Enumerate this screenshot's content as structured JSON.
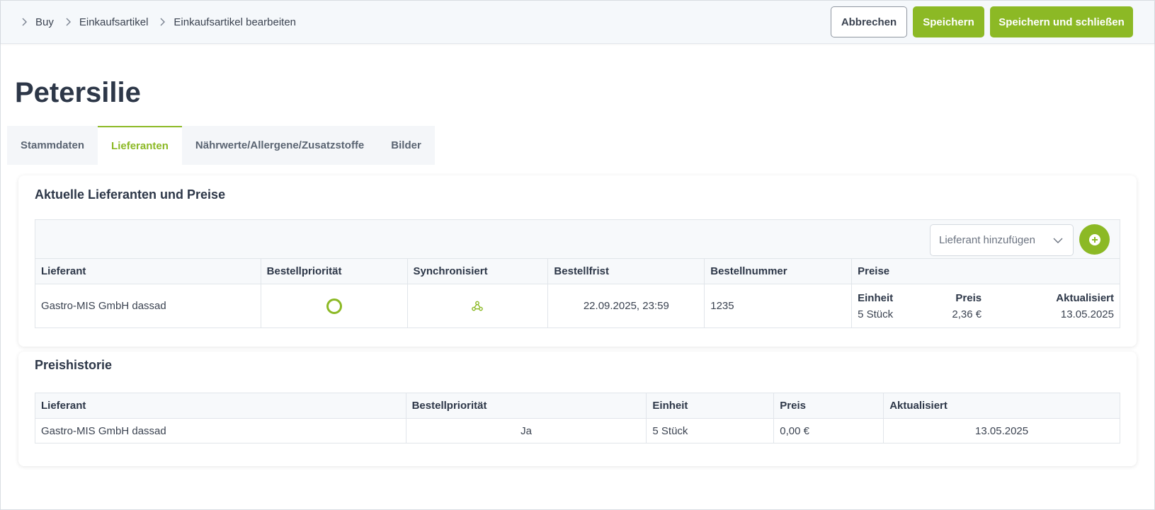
{
  "breadcrumb": {
    "items": [
      "Buy",
      "Einkaufsartikel",
      "Einkaufsartikel bearbeiten"
    ]
  },
  "header_actions": {
    "cancel_label": "Abbrechen",
    "save_label": "Speichern",
    "save_close_label": "Speichern und schließen"
  },
  "page_title": "Petersilie",
  "tabs": [
    {
      "label": "Stammdaten",
      "active": false
    },
    {
      "label": "Lieferanten",
      "active": true
    },
    {
      "label": "Nährwerte/Allergene/Zusatzstoffe",
      "active": false
    },
    {
      "label": "Bilder",
      "active": false
    }
  ],
  "current_suppliers": {
    "title": "Aktuelle Lieferanten und Preise",
    "add_supplier_placeholder": "Lieferant hinzufügen",
    "columns": [
      "Lieferant",
      "Bestellpriorität",
      "Synchronisiert",
      "Bestellfrist",
      "Bestellnummer",
      "Preise"
    ],
    "rows": [
      {
        "lieferant": "Gastro-MIS GmbH dassad",
        "priority_icon": "radio-ring-icon",
        "sync_icon": "sync-network-icon",
        "bestellfrist": "22.09.2025, 23:59",
        "bestellnummer": "1235",
        "prices": {
          "headers": [
            "Einheit",
            "Preis",
            "Aktualisiert"
          ],
          "rows": [
            [
              "5 Stück",
              "2,36 €",
              "13.05.2025"
            ]
          ]
        }
      }
    ]
  },
  "price_history": {
    "title": "Preishistorie",
    "columns": [
      "Lieferant",
      "Bestellpriorität",
      "Einheit",
      "Preis",
      "Aktualisiert"
    ],
    "rows": [
      [
        "Gastro-MIS GmbH dassad",
        "Ja",
        "5 Stück",
        "0,00 €",
        "13.05.2025"
      ]
    ]
  },
  "colors": {
    "accent": "#8cb925",
    "text": "#2d3748",
    "header_bg": "#f5f8fb"
  }
}
